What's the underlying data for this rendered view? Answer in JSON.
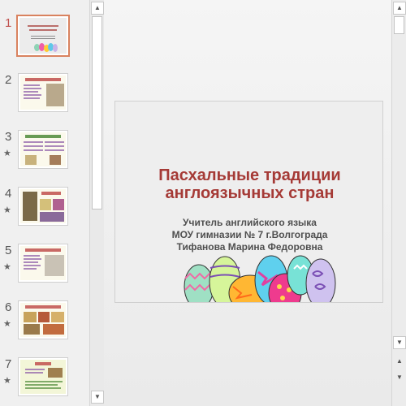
{
  "slides": [
    {
      "number": "1",
      "starred": false,
      "active": true
    },
    {
      "number": "2",
      "starred": false,
      "active": false
    },
    {
      "number": "3",
      "starred": true,
      "active": false
    },
    {
      "number": "4",
      "starred": true,
      "active": false
    },
    {
      "number": "5",
      "starred": true,
      "active": false
    },
    {
      "number": "6",
      "starred": true,
      "active": false
    },
    {
      "number": "7",
      "starred": true,
      "active": false
    }
  ],
  "star_glyph": "★",
  "current_slide": {
    "title_line1": "Пасхальные традиции",
    "title_line2": "англоязычных стран",
    "subtitle_line1": "Учитель английского языка",
    "subtitle_line2": "МОУ гимназии № 7 г.Волгограда",
    "subtitle_line3": "Тифанова Марина Федоровна"
  },
  "scroll_icons": {
    "up": "▲",
    "down": "▼",
    "prev": "▲",
    "next": "▼"
  },
  "colors": {
    "accent": "#c0504d",
    "title": "#a53a36",
    "selection": "#d9825f"
  }
}
